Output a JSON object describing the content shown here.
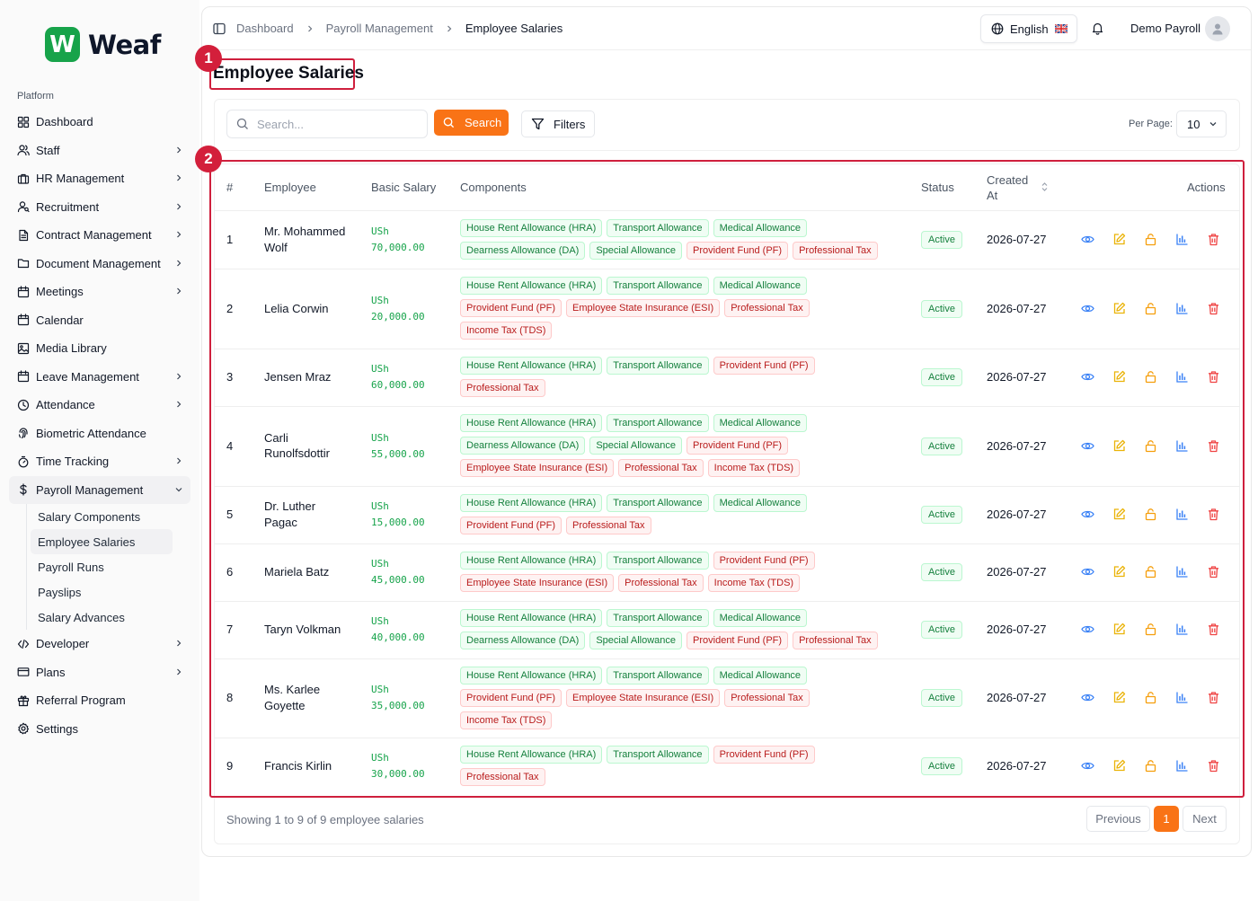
{
  "app": {
    "name": "Weaf",
    "logo_letter": "W"
  },
  "sidebar": {
    "section": "Platform",
    "items": [
      {
        "label": "Dashboard",
        "icon": "grid-icon",
        "chev": false
      },
      {
        "label": "Staff",
        "icon": "users-icon",
        "chev": true
      },
      {
        "label": "HR Management",
        "icon": "briefcase-icon",
        "chev": true
      },
      {
        "label": "Recruitment",
        "icon": "user-search-icon",
        "chev": true
      },
      {
        "label": "Contract Management",
        "icon": "file-icon",
        "chev": true
      },
      {
        "label": "Document Management",
        "icon": "folder-icon",
        "chev": true
      },
      {
        "label": "Meetings",
        "icon": "calendar-icon",
        "chev": true
      },
      {
        "label": "Calendar",
        "icon": "calendar-icon",
        "chev": false
      },
      {
        "label": "Media Library",
        "icon": "image-icon",
        "chev": false
      },
      {
        "label": "Leave Management",
        "icon": "calendar-icon",
        "chev": true
      },
      {
        "label": "Attendance",
        "icon": "clock-icon",
        "chev": true
      },
      {
        "label": "Biometric Attendance",
        "icon": "fingerprint-icon",
        "chev": false
      },
      {
        "label": "Time Tracking",
        "icon": "timer-icon",
        "chev": true
      }
    ],
    "payroll": {
      "label": "Payroll Management",
      "icon": "dollar-icon"
    },
    "payroll_sub": [
      "Salary Components",
      "Employee Salaries",
      "Payroll Runs",
      "Payslips",
      "Salary Advances"
    ],
    "items_after": [
      {
        "label": "Developer",
        "icon": "code-icon",
        "chev": true
      },
      {
        "label": "Plans",
        "icon": "credit-card-icon",
        "chev": true
      },
      {
        "label": "Referral Program",
        "icon": "gift-icon",
        "chev": false
      },
      {
        "label": "Settings",
        "icon": "gear-icon",
        "chev": false
      }
    ]
  },
  "header": {
    "breadcrumbs": [
      "Dashboard",
      "Payroll Management",
      "Employee Salaries"
    ],
    "language": "English",
    "user": "Demo Payroll"
  },
  "page": {
    "title": "Employee Salaries",
    "annotations": [
      "1",
      "2"
    ]
  },
  "toolbar": {
    "search_placeholder": "Search...",
    "search_button": "Search",
    "filters_button": "Filters",
    "per_page_label": "Per Page:",
    "per_page_value": "10"
  },
  "table": {
    "headers": {
      "num": "#",
      "employee": "Employee",
      "salary": "Basic Salary",
      "components": "Components",
      "status": "Status",
      "created": "Created At",
      "actions": "Actions"
    },
    "rows": [
      {
        "num": "1",
        "employee": "Mr. Mohammed Wolf",
        "emp_lines": [
          "Mr. Mohammed",
          "Wolf"
        ],
        "currency": "USh",
        "salary": "70,000.00",
        "status": "Active",
        "created": "2026-07-27",
        "components": [
          [
            "House Rent Allowance (HRA)",
            "g"
          ],
          [
            "Transport Allowance",
            "g"
          ],
          [
            "Medical Allowance",
            "g"
          ],
          [
            "Dearness Allowance (DA)",
            "g"
          ],
          [
            "Special Allowance",
            "g"
          ],
          [
            "Provident Fund (PF)",
            "r"
          ],
          [
            "Professional Tax",
            "r"
          ]
        ]
      },
      {
        "num": "2",
        "employee": "Lelia Corwin",
        "emp_lines": [
          "Lelia Corwin"
        ],
        "currency": "USh",
        "salary": "20,000.00",
        "status": "Active",
        "created": "2026-07-27",
        "components": [
          [
            "House Rent Allowance (HRA)",
            "g"
          ],
          [
            "Transport Allowance",
            "g"
          ],
          [
            "Medical Allowance",
            "g"
          ],
          [
            "Provident Fund (PF)",
            "r"
          ],
          [
            "Employee State Insurance (ESI)",
            "r"
          ],
          [
            "Professional Tax",
            "r"
          ],
          [
            "Income Tax (TDS)",
            "r"
          ]
        ]
      },
      {
        "num": "3",
        "employee": "Jensen Mraz",
        "emp_lines": [
          "Jensen Mraz"
        ],
        "currency": "USh",
        "salary": "60,000.00",
        "status": "Active",
        "created": "2026-07-27",
        "components": [
          [
            "House Rent Allowance (HRA)",
            "g"
          ],
          [
            "Transport Allowance",
            "g"
          ],
          [
            "Provident Fund (PF)",
            "r"
          ],
          [
            "Professional Tax",
            "r"
          ]
        ]
      },
      {
        "num": "4",
        "employee": "Carli Runolfsdottir",
        "emp_lines": [
          "Carli",
          "Runolfsdottir"
        ],
        "currency": "USh",
        "salary": "55,000.00",
        "status": "Active",
        "created": "2026-07-27",
        "components": [
          [
            "House Rent Allowance (HRA)",
            "g"
          ],
          [
            "Transport Allowance",
            "g"
          ],
          [
            "Medical Allowance",
            "g"
          ],
          [
            "Dearness Allowance (DA)",
            "g"
          ],
          [
            "Special Allowance",
            "g"
          ],
          [
            "Provident Fund (PF)",
            "r"
          ],
          [
            "Employee State Insurance (ESI)",
            "r"
          ],
          [
            "Professional Tax",
            "r"
          ],
          [
            "Income Tax (TDS)",
            "r"
          ]
        ]
      },
      {
        "num": "5",
        "employee": "Dr. Luther Pagac",
        "emp_lines": [
          "Dr. Luther",
          "Pagac"
        ],
        "currency": "USh",
        "salary": "15,000.00",
        "status": "Active",
        "created": "2026-07-27",
        "components": [
          [
            "House Rent Allowance (HRA)",
            "g"
          ],
          [
            "Transport Allowance",
            "g"
          ],
          [
            "Medical Allowance",
            "g"
          ],
          [
            "Provident Fund (PF)",
            "r"
          ],
          [
            "Professional Tax",
            "r"
          ]
        ]
      },
      {
        "num": "6",
        "employee": "Mariela Batz",
        "emp_lines": [
          "Mariela Batz"
        ],
        "currency": "USh",
        "salary": "45,000.00",
        "status": "Active",
        "created": "2026-07-27",
        "components": [
          [
            "House Rent Allowance (HRA)",
            "g"
          ],
          [
            "Transport Allowance",
            "g"
          ],
          [
            "Provident Fund (PF)",
            "r"
          ],
          [
            "Employee State Insurance (ESI)",
            "r"
          ],
          [
            "Professional Tax",
            "r"
          ],
          [
            "Income Tax (TDS)",
            "r"
          ]
        ]
      },
      {
        "num": "7",
        "employee": "Taryn Volkman",
        "emp_lines": [
          "Taryn Volkman"
        ],
        "currency": "USh",
        "salary": "40,000.00",
        "status": "Active",
        "created": "2026-07-27",
        "components": [
          [
            "House Rent Allowance (HRA)",
            "g"
          ],
          [
            "Transport Allowance",
            "g"
          ],
          [
            "Medical Allowance",
            "g"
          ],
          [
            "Dearness Allowance (DA)",
            "g"
          ],
          [
            "Special Allowance",
            "g"
          ],
          [
            "Provident Fund (PF)",
            "r"
          ],
          [
            "Professional Tax",
            "r"
          ]
        ]
      },
      {
        "num": "8",
        "employee": "Ms. Karlee Goyette",
        "emp_lines": [
          "Ms. Karlee",
          "Goyette"
        ],
        "currency": "USh",
        "salary": "35,000.00",
        "status": "Active",
        "created": "2026-07-27",
        "components": [
          [
            "House Rent Allowance (HRA)",
            "g"
          ],
          [
            "Transport Allowance",
            "g"
          ],
          [
            "Medical Allowance",
            "g"
          ],
          [
            "Provident Fund (PF)",
            "r"
          ],
          [
            "Employee State Insurance (ESI)",
            "r"
          ],
          [
            "Professional Tax",
            "r"
          ],
          [
            "Income Tax (TDS)",
            "r"
          ]
        ]
      },
      {
        "num": "9",
        "employee": "Francis Kirlin",
        "emp_lines": [
          "Francis Kirlin"
        ],
        "currency": "USh",
        "salary": "30,000.00",
        "status": "Active",
        "created": "2026-07-27",
        "components": [
          [
            "House Rent Allowance (HRA)",
            "g"
          ],
          [
            "Transport Allowance",
            "g"
          ],
          [
            "Provident Fund (PF)",
            "r"
          ],
          [
            "Professional Tax",
            "r"
          ]
        ]
      }
    ]
  },
  "footer": {
    "summary": "Showing 1 to 9 of 9 employee salaries",
    "prev": "Previous",
    "page": "1",
    "next": "Next"
  },
  "colors": {
    "brand": "#17a34a",
    "accent": "#f97316",
    "annotation": "#d31f3b",
    "positive": "#15803d",
    "negative": "#b91c1c"
  }
}
